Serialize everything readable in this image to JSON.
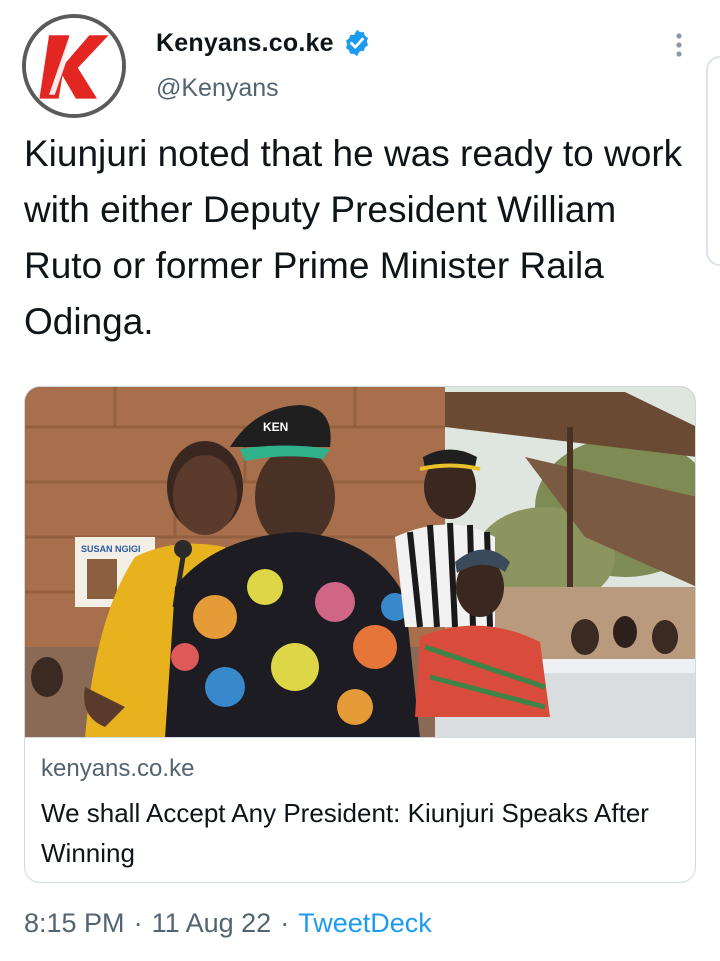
{
  "account": {
    "display_name": "Kenyans.co.ke",
    "handle": "@Kenyans",
    "avatar_icon": "kenyans-k-logo",
    "verified_icon": "verified-badge-icon",
    "verified_color": "#1d9bf0",
    "avatar_border_color": "#5b5b5b",
    "logo_color": "#e32622"
  },
  "menu": {
    "icon": "more-vertical-icon"
  },
  "tweet": {
    "text": "Kiunjuri noted that he was ready to work with either Deputy President William Ruto or former Prime Minister Raila Odinga."
  },
  "link_card": {
    "domain": "kenyans.co.ke",
    "title": "We shall Accept Any President: Kiunjuri Speaks After Winning",
    "image": {
      "poster_text": "SUSAN NGIGI",
      "cap_text": "KEN"
    }
  },
  "meta": {
    "time": "8:15 PM",
    "separator": "·",
    "date": "11 Aug 22",
    "source": "TweetDeck",
    "source_color": "#1d9bf0"
  }
}
